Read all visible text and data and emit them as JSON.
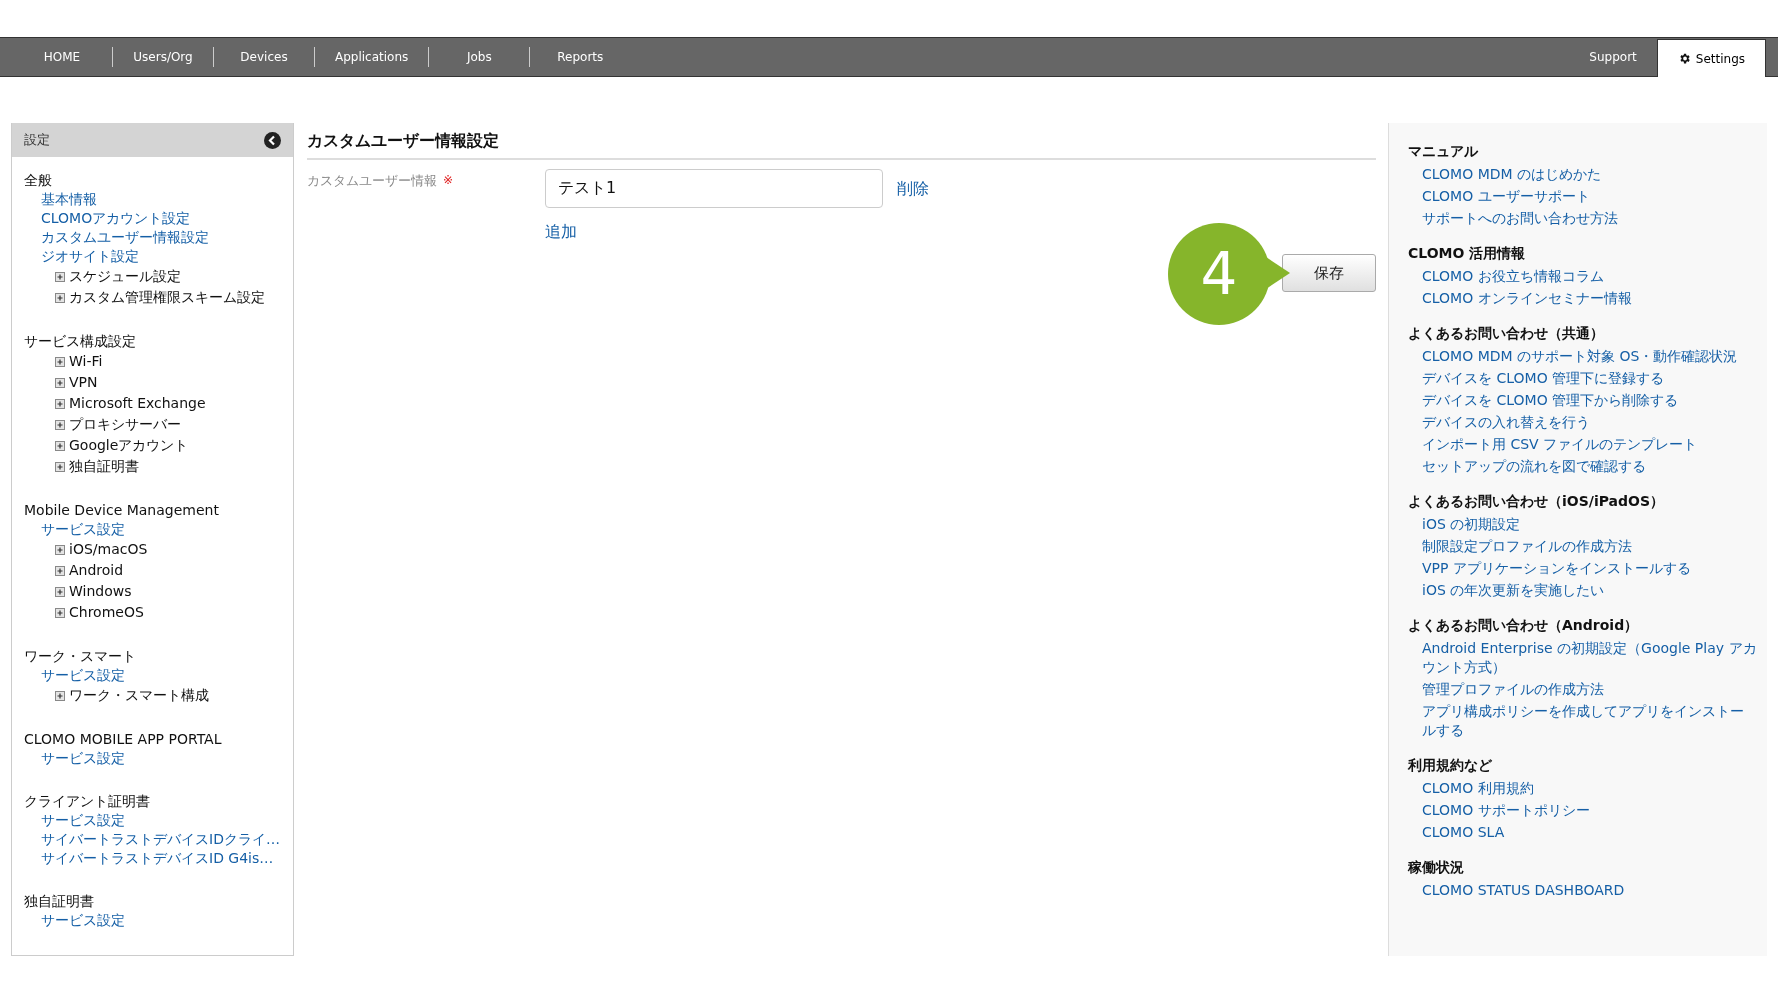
{
  "nav": {
    "items": [
      {
        "label": "HOME",
        "selected": false
      },
      {
        "label": "Users/Org",
        "selected": false
      },
      {
        "label": "Devices",
        "selected": false
      },
      {
        "label": "Applications",
        "selected": false
      },
      {
        "label": "Jobs",
        "selected": false
      },
      {
        "label": "Reports",
        "selected": false
      }
    ],
    "right_items": [
      {
        "label": "Support",
        "selected": false,
        "kind": "text"
      },
      {
        "label": "Settings",
        "selected": true,
        "kind": "gear"
      }
    ]
  },
  "sidebar": {
    "title": "設定",
    "sections": [
      {
        "title": "全般",
        "items": [
          {
            "kind": "link",
            "label": "基本情報"
          },
          {
            "kind": "link",
            "label": "CLOMOアカウント設定"
          },
          {
            "kind": "link",
            "label": "カスタムユーザー情報設定"
          },
          {
            "kind": "link",
            "label": "ジオサイト設定"
          },
          {
            "kind": "expandable",
            "label": "スケジュール設定"
          },
          {
            "kind": "expandable",
            "label": "カスタム管理権限スキーム設定"
          }
        ]
      },
      {
        "title": "サービス構成設定",
        "items": [
          {
            "kind": "expandable",
            "label": "Wi-Fi"
          },
          {
            "kind": "expandable",
            "label": "VPN"
          },
          {
            "kind": "expandable",
            "label": "Microsoft Exchange"
          },
          {
            "kind": "expandable",
            "label": "プロキシサーバー"
          },
          {
            "kind": "expandable",
            "label": "Googleアカウント"
          },
          {
            "kind": "expandable",
            "label": "独自証明書"
          }
        ]
      },
      {
        "title": "Mobile Device Management",
        "items": [
          {
            "kind": "link",
            "label": "サービス設定"
          },
          {
            "kind": "expandable",
            "label": "iOS/macOS"
          },
          {
            "kind": "expandable",
            "label": "Android"
          },
          {
            "kind": "expandable",
            "label": "Windows"
          },
          {
            "kind": "expandable",
            "label": "ChromeOS"
          }
        ]
      },
      {
        "title": "ワーク・スマート",
        "items": [
          {
            "kind": "link",
            "label": "サービス設定"
          },
          {
            "kind": "expandable",
            "label": "ワーク・スマート構成"
          }
        ]
      },
      {
        "title": "CLOMO MOBILE APP PORTAL",
        "items": [
          {
            "kind": "link",
            "label": "サービス設定"
          }
        ]
      },
      {
        "title": "クライアント証明書",
        "items": [
          {
            "kind": "link",
            "label": "サービス設定"
          },
          {
            "kind": "link",
            "label": "サイバートラストデバイスIDクライ…"
          },
          {
            "kind": "link",
            "label": "サイバートラストデバイスID G4is…"
          }
        ]
      },
      {
        "title": "独自証明書",
        "items": [
          {
            "kind": "link",
            "label": "サービス設定"
          }
        ]
      }
    ]
  },
  "main": {
    "title": "カスタムユーザー情報設定",
    "field_label": "カスタムユーザー情報",
    "required_mark": "※",
    "value": "テスト1",
    "delete_link": "削除",
    "add_link": "追加",
    "save_button": "保存",
    "step_badge": "4"
  },
  "help": {
    "sections": [
      {
        "title": "マニュアル",
        "links": [
          "CLOMO MDM のはじめかた",
          "CLOMO ユーザーサポート",
          "サポートへのお問い合わせ方法"
        ]
      },
      {
        "title": "CLOMO 活用情報",
        "links": [
          "CLOMO お役立ち情報コラム",
          "CLOMO オンラインセミナー情報"
        ]
      },
      {
        "title": "よくあるお問い合わせ（共通）",
        "links": [
          "CLOMO MDM のサポート対象 OS・動作確認状況",
          "デバイスを CLOMO 管理下に登録する",
          "デバイスを CLOMO 管理下から削除する",
          "デバイスの入れ替えを行う",
          "インポート用 CSV ファイルのテンプレート",
          "セットアップの流れを図で確認する"
        ]
      },
      {
        "title": "よくあるお問い合わせ（iOS/iPadOS）",
        "links": [
          "iOS の初期設定",
          "制限設定プロファイルの作成方法",
          "VPP アプリケーションをインストールする",
          "iOS の年次更新を実施したい"
        ]
      },
      {
        "title": "よくあるお問い合わせ（Android）",
        "links": [
          "Android Enterprise の初期設定（Google Play アカウント方式）",
          "管理プロファイルの作成方法",
          "アプリ構成ポリシーを作成してアプリをインストールする"
        ]
      },
      {
        "title": "利用規約など",
        "links": [
          "CLOMO 利用規約",
          "CLOMO サポートポリシー",
          "CLOMO SLA"
        ]
      },
      {
        "title": "稼働状況",
        "links": [
          "CLOMO STATUS DASHBOARD"
        ]
      }
    ]
  }
}
